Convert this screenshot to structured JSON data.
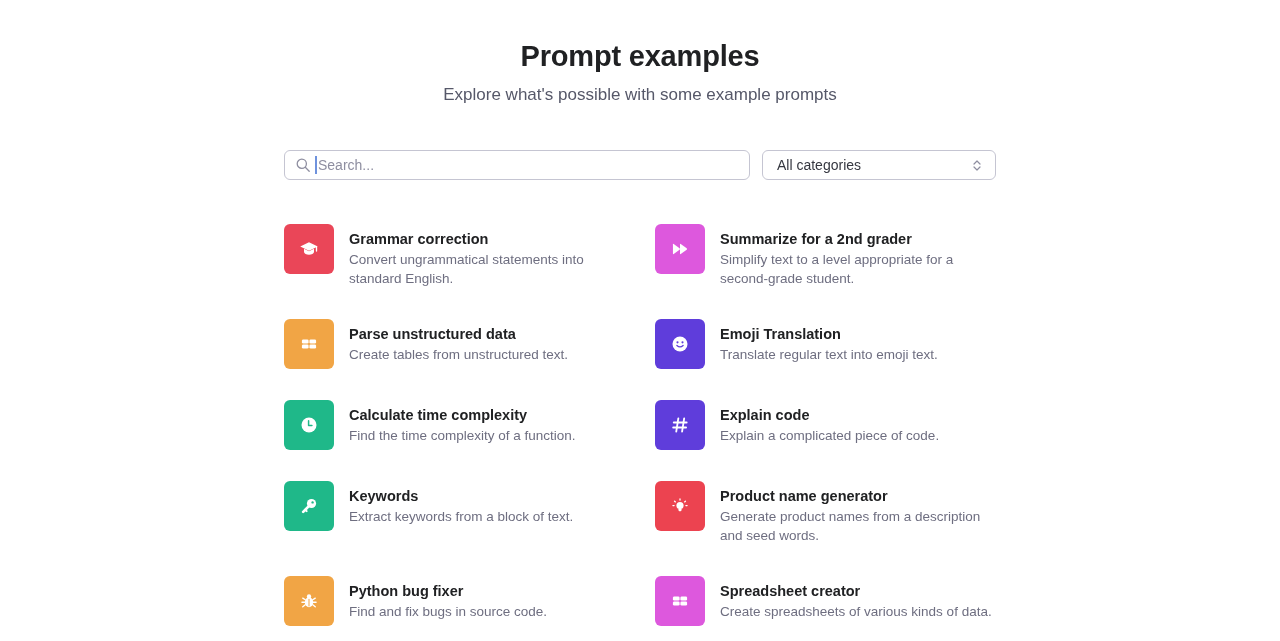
{
  "header": {
    "title": "Prompt examples",
    "subtitle": "Explore what's possible with some example prompts"
  },
  "search": {
    "placeholder": "Search...",
    "focused": true
  },
  "category_select": {
    "value": "All categories"
  },
  "prompts": [
    {
      "title": "Grammar correction",
      "description": "Convert ungrammatical statements into standard English.",
      "color": "#ea4658"
    },
    {
      "title": "Summarize for a 2nd grader",
      "description": "Simplify text to a level appropriate for a second-grade student.",
      "color": "#dd58dd"
    },
    {
      "title": "Parse unstructured data",
      "description": "Create tables from unstructured text.",
      "color": "#f1a545"
    },
    {
      "title": "Emoji Translation",
      "description": "Translate regular text into emoji text.",
      "color": "#5f3ddb"
    },
    {
      "title": "Calculate time complexity",
      "description": "Find the time complexity of a function.",
      "color": "#1fb889"
    },
    {
      "title": "Explain code",
      "description": "Explain a complicated piece of code.",
      "color": "#5f3ddb"
    },
    {
      "title": "Keywords",
      "description": "Extract keywords from a block of text.",
      "color": "#1fb889"
    },
    {
      "title": "Product name generator",
      "description": "Generate product names from a description and seed words.",
      "color": "#ec4350"
    },
    {
      "title": "Python bug fixer",
      "description": "Find and fix bugs in source code.",
      "color": "#f1a545"
    },
    {
      "title": "Spreadsheet creator",
      "description": "Create spreadsheets of various kinds of data.",
      "color": "#dd58dd"
    }
  ]
}
